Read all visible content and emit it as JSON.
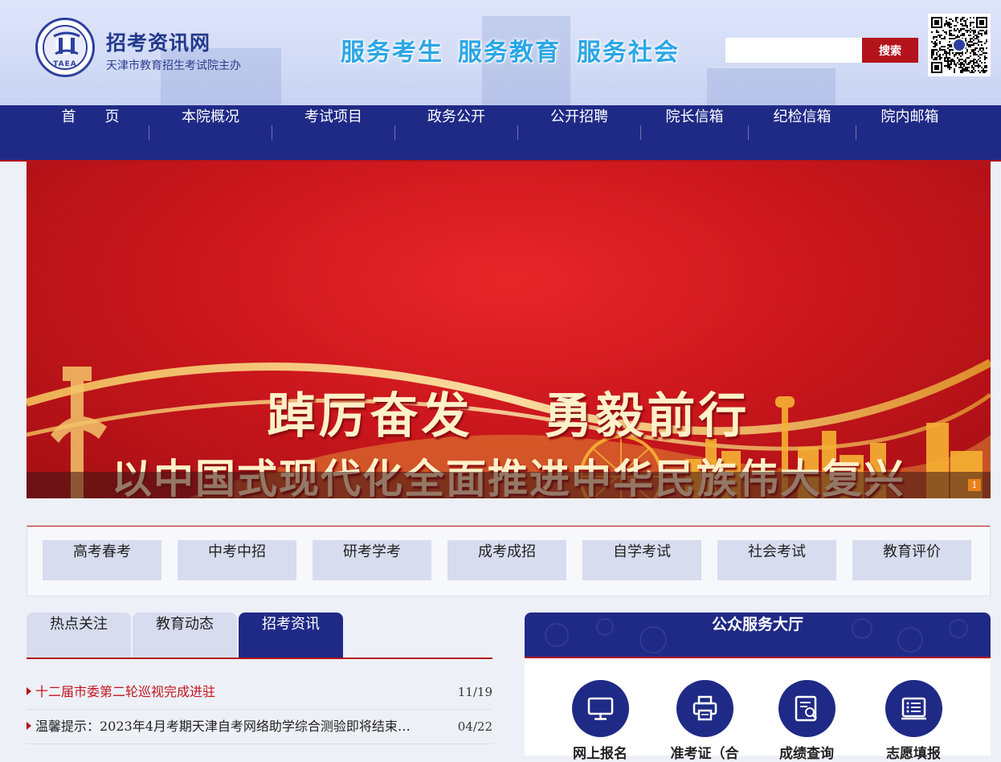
{
  "header": {
    "site_title": "招考资讯网",
    "site_subtitle": "天津市教育招生考试院主办",
    "logo_text": "TAEA",
    "slogans": [
      "服务考生",
      "服务教育",
      "服务社会"
    ],
    "search": {
      "placeholder": "",
      "button_label": "搜索"
    }
  },
  "nav": {
    "items": [
      "首　　页",
      "本院概况",
      "考试项目",
      "政务公开",
      "公开招聘",
      "院长信箱",
      "纪检信箱",
      "院内邮箱"
    ]
  },
  "banner": {
    "line1": "踔厉奋发　 勇毅前行",
    "line2": "以中国式现代化全面推进中华民族伟大复兴",
    "pager_current": "1"
  },
  "categories": [
    "高考春考",
    "中考中招",
    "研考学考",
    "成考成招",
    "自学考试",
    "社会考试",
    "教育评价"
  ],
  "news": {
    "tabs": [
      {
        "label": "热点关注",
        "active": false
      },
      {
        "label": "教育动态",
        "active": false
      },
      {
        "label": "招考资讯",
        "active": true
      }
    ],
    "items": [
      {
        "title": "十二届市委第二轮巡视完成进驻",
        "date": "11/19",
        "hot": true
      },
      {
        "title": "温馨提示：2023年4月考期天津自考网络助学综合测验即将结束，…",
        "date": "04/22",
        "hot": false
      }
    ]
  },
  "service_hall": {
    "title": "公众服务大厅",
    "items": [
      {
        "label": "网上报名",
        "icon": "monitor-icon"
      },
      {
        "label": "准考证（合",
        "icon": "printer-icon"
      },
      {
        "label": "成绩查询",
        "icon": "report-search-icon"
      },
      {
        "label": "志愿填报",
        "icon": "form-list-icon"
      }
    ]
  },
  "colors": {
    "nav_blue": "#1f2a86",
    "accent_red": "#b3141b",
    "slogan_blue": "#2aa6e6",
    "banner_red": "#c9161c",
    "category_bg": "#d8dcef"
  }
}
